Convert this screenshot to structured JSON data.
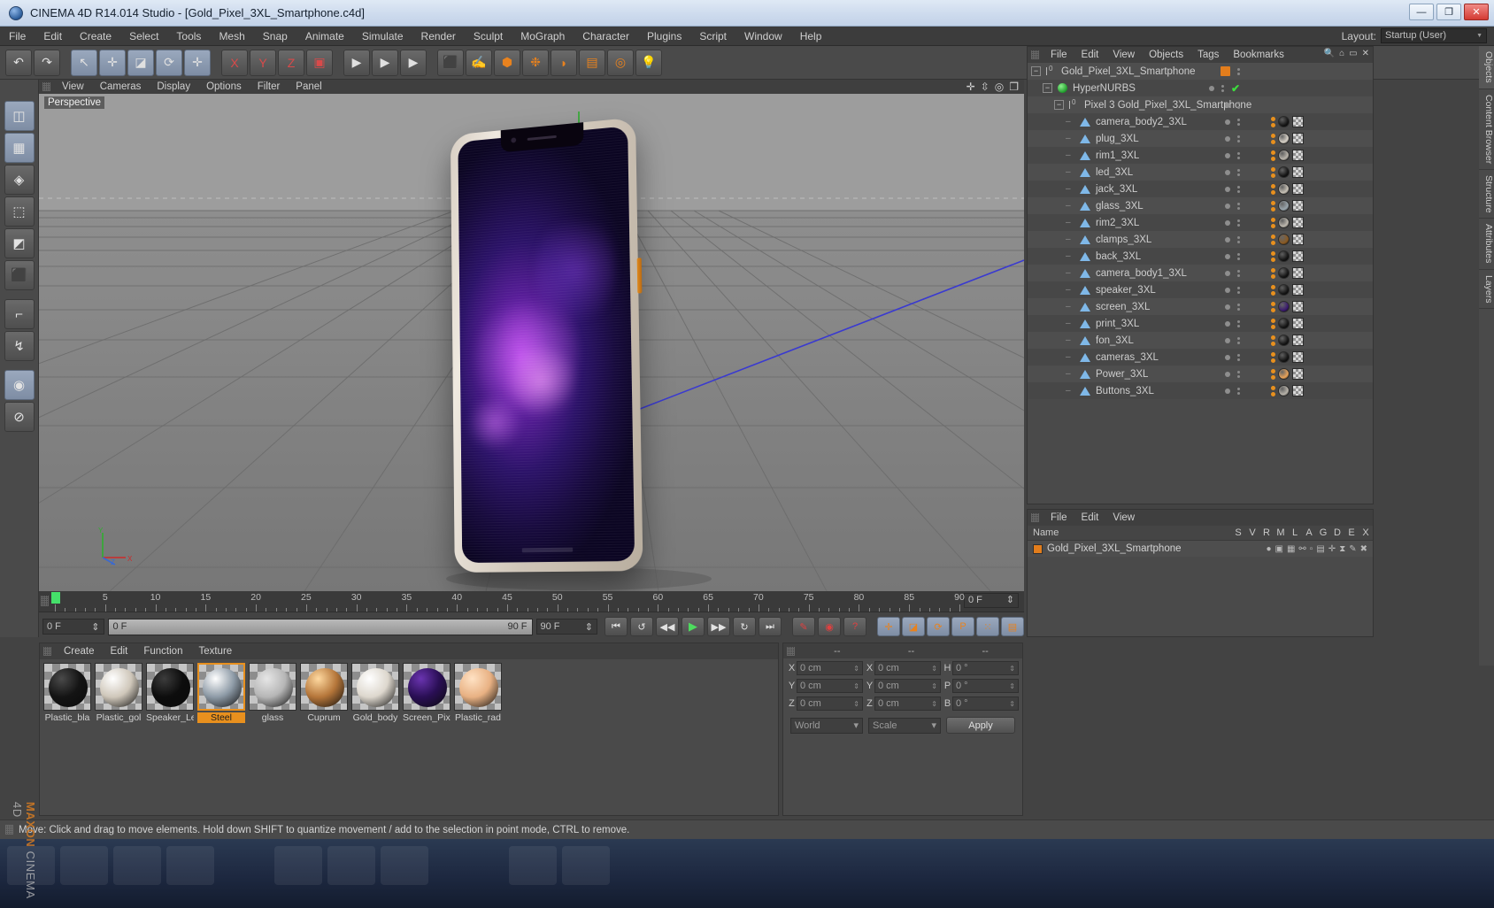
{
  "window": {
    "title": "CINEMA 4D R14.014 Studio - [Gold_Pixel_3XL_Smartphone.c4d]",
    "app_icon": "cinema4d-logo-icon",
    "minimize": "—",
    "maximize": "❐",
    "close": "✕"
  },
  "menubar": {
    "items": [
      "File",
      "Edit",
      "Create",
      "Select",
      "Tools",
      "Mesh",
      "Snap",
      "Animate",
      "Simulate",
      "Render",
      "Sculpt",
      "MoGraph",
      "Character",
      "Plugins",
      "Script",
      "Window",
      "Help"
    ],
    "layout_label": "Layout:",
    "layout_value": "Startup (User)"
  },
  "toolbar": {
    "buttons": [
      {
        "name": "undo-button",
        "glyph": "↶"
      },
      {
        "name": "redo-button",
        "glyph": "↷"
      },
      {
        "name": "select-tool-button",
        "glyph": "↖",
        "active": true
      },
      {
        "name": "move-tool-button",
        "glyph": "✛",
        "active": true
      },
      {
        "name": "scale-tool-button",
        "glyph": "◪",
        "active": true
      },
      {
        "name": "rotate-tool-button",
        "glyph": "⟳",
        "active": true
      },
      {
        "name": "add-tool-button",
        "glyph": "✛",
        "active": true
      },
      {
        "name": "lock-x-axis-button",
        "glyph": "X"
      },
      {
        "name": "lock-y-axis-button",
        "glyph": "Y"
      },
      {
        "name": "lock-z-axis-button",
        "glyph": "Z"
      },
      {
        "name": "world-object-coordinate-button",
        "glyph": "▣"
      },
      {
        "name": "render-view-button",
        "glyph": "▶"
      },
      {
        "name": "render-region-button",
        "glyph": "▶"
      },
      {
        "name": "render-settings-button",
        "glyph": "▶"
      },
      {
        "name": "add-cube-button",
        "glyph": "⬛"
      },
      {
        "name": "add-spline-button",
        "glyph": "✍"
      },
      {
        "name": "add-generator-button",
        "glyph": "⬢"
      },
      {
        "name": "add-mograph-button",
        "glyph": "❉"
      },
      {
        "name": "add-deformer-button",
        "glyph": "◗"
      },
      {
        "name": "add-scene-button",
        "glyph": "▤"
      },
      {
        "name": "add-camera-button",
        "glyph": "◎"
      },
      {
        "name": "add-light-button",
        "glyph": "💡"
      }
    ]
  },
  "left_tools": [
    {
      "name": "make-editable-button",
      "glyph": "◫",
      "active": true
    },
    {
      "name": "model-mode-button",
      "glyph": "▦",
      "active": true
    },
    {
      "name": "texture-mode-button",
      "glyph": "◈",
      "active": false
    },
    {
      "name": "point-mode-button",
      "glyph": "⬚",
      "active": false
    },
    {
      "name": "edge-mode-button",
      "glyph": "◩",
      "active": false
    },
    {
      "name": "polygon-mode-button",
      "glyph": "⬛",
      "active": false
    },
    {
      "name": "axis-mode-button",
      "glyph": "⌐",
      "active": false
    },
    {
      "name": "enable-snapping-button",
      "glyph": "↯",
      "active": false
    },
    {
      "name": "viewport-solo-button",
      "glyph": "◉",
      "active": true
    },
    {
      "name": "lock-workplane-button",
      "glyph": "⊘",
      "active": false
    }
  ],
  "viewport": {
    "menu": [
      "View",
      "Cameras",
      "Display",
      "Options",
      "Filter",
      "Panel"
    ],
    "label": "Perspective",
    "nav_icons": [
      "pan-icon",
      "dolly-icon",
      "orbit-icon",
      "maximize-viewport-icon"
    ],
    "axis": {
      "x": "X",
      "y": "Y",
      "z": "Z"
    }
  },
  "object_manager": {
    "menu": [
      "File",
      "Edit",
      "View",
      "Objects",
      "Tags",
      "Bookmarks"
    ],
    "header_icons": [
      "search-icon",
      "home-icon",
      "collapse-icon",
      "close-icon"
    ],
    "items": [
      {
        "label": "Gold_Pixel_3XL_Smartphone",
        "icon": "null-object-icon",
        "depth": 0,
        "expander": "−",
        "swatch": "#e27d1c",
        "has_tags": false,
        "check": false
      },
      {
        "label": "HyperNURBS",
        "icon": "hypernurbs-icon",
        "depth": 1,
        "expander": "−",
        "swatch": "",
        "has_tags": false,
        "check": true
      },
      {
        "label": "Pixel 3 Gold_Pixel_3XL_Smartphone",
        "icon": "null-object-icon",
        "depth": 2,
        "expander": "−",
        "swatch": "",
        "has_tags": false,
        "check": false
      },
      {
        "label": "camera_body2_3XL",
        "icon": "polygon-object-icon",
        "depth": 3,
        "expander": "",
        "swatch": "",
        "has_tags": true,
        "mat": "#151515"
      },
      {
        "label": "plug_3XL",
        "icon": "polygon-object-icon",
        "depth": 3,
        "expander": "",
        "swatch": "",
        "has_tags": true,
        "mat": "#d8d2c8"
      },
      {
        "label": "rim1_3XL",
        "icon": "polygon-object-icon",
        "depth": 3,
        "expander": "",
        "swatch": "",
        "has_tags": true,
        "mat": "#b9b4ab"
      },
      {
        "label": "led_3XL",
        "icon": "polygon-object-icon",
        "depth": 3,
        "expander": "",
        "swatch": "",
        "has_tags": true,
        "mat": "#151515"
      },
      {
        "label": "jack_3XL",
        "icon": "polygon-object-icon",
        "depth": 3,
        "expander": "",
        "swatch": "",
        "has_tags": true,
        "mat": "#c8c2b6"
      },
      {
        "label": "glass_3XL",
        "icon": "polygon-object-icon",
        "depth": 3,
        "expander": "",
        "swatch": "",
        "has_tags": true,
        "mat": "#9aa6ad"
      },
      {
        "label": "rim2_3XL",
        "icon": "polygon-object-icon",
        "depth": 3,
        "expander": "",
        "swatch": "",
        "has_tags": true,
        "mat": "#bdb8ae"
      },
      {
        "label": "clamps_3XL",
        "icon": "polygon-object-icon",
        "depth": 3,
        "expander": "",
        "swatch": "",
        "has_tags": true,
        "mat": "#8a5a23"
      },
      {
        "label": "back_3XL",
        "icon": "polygon-object-icon",
        "depth": 3,
        "expander": "",
        "swatch": "",
        "has_tags": true,
        "mat": "#151515"
      },
      {
        "label": "camera_body1_3XL",
        "icon": "polygon-object-icon",
        "depth": 3,
        "expander": "",
        "swatch": "",
        "has_tags": true,
        "mat": "#151515"
      },
      {
        "label": "speaker_3XL",
        "icon": "polygon-object-icon",
        "depth": 3,
        "expander": "",
        "swatch": "",
        "has_tags": true,
        "mat": "#151515"
      },
      {
        "label": "screen_3XL",
        "icon": "polygon-object-icon",
        "depth": 3,
        "expander": "",
        "swatch": "",
        "has_tags": true,
        "mat": "#3a1a6e"
      },
      {
        "label": "print_3XL",
        "icon": "polygon-object-icon",
        "depth": 3,
        "expander": "",
        "swatch": "",
        "has_tags": true,
        "mat": "#151515"
      },
      {
        "label": "fon_3XL",
        "icon": "polygon-object-icon",
        "depth": 3,
        "expander": "",
        "swatch": "",
        "has_tags": true,
        "mat": "#151515"
      },
      {
        "label": "cameras_3XL",
        "icon": "polygon-object-icon",
        "depth": 3,
        "expander": "",
        "swatch": "",
        "has_tags": true,
        "mat": "#151515"
      },
      {
        "label": "Power_3XL",
        "icon": "polygon-object-icon",
        "depth": 3,
        "expander": "",
        "swatch": "",
        "has_tags": true,
        "mat": "#e8a35a"
      },
      {
        "label": "Buttons_3XL",
        "icon": "polygon-object-icon",
        "depth": 3,
        "expander": "",
        "swatch": "",
        "has_tags": true,
        "mat": "#b8b3aa"
      }
    ]
  },
  "attributes_panel": {
    "menu": [
      "File",
      "Edit",
      "View"
    ],
    "columns": [
      "Name",
      "S",
      "V",
      "R",
      "M",
      "L",
      "A",
      "G",
      "D",
      "E",
      "X"
    ],
    "rows": [
      {
        "name": "Gold_Pixel_3XL_Smartphone",
        "swatch": "#e27d1c"
      }
    ]
  },
  "right_dock_tabs": [
    {
      "label": "Objects",
      "selected": true
    },
    {
      "label": "Content Browser",
      "selected": false
    },
    {
      "label": "Structure",
      "selected": false
    },
    {
      "label": "Attributes",
      "selected": false
    },
    {
      "label": "Layers",
      "selected": false
    }
  ],
  "timeline": {
    "ruler_labels": [
      "0",
      "5",
      "10",
      "15",
      "20",
      "25",
      "30",
      "35",
      "40",
      "45",
      "50",
      "55",
      "60",
      "65",
      "70",
      "75",
      "80",
      "85",
      "90"
    ],
    "current_frame_right": "0 F",
    "current_frame_field": "0 F",
    "range_start": "0 F",
    "range_end": "90 F",
    "max_frame_field": "90 F",
    "playhead_frame": 0,
    "transport": [
      {
        "name": "go-to-start-button",
        "glyph": "⏮"
      },
      {
        "name": "play-reverse-button",
        "glyph": "↺"
      },
      {
        "name": "step-back-button",
        "glyph": "◀◀"
      },
      {
        "name": "play-button",
        "glyph": "▶"
      },
      {
        "name": "step-forward-button",
        "glyph": "▶▶"
      },
      {
        "name": "loop-button",
        "glyph": "↻"
      },
      {
        "name": "go-to-end-button",
        "glyph": "⏭"
      }
    ],
    "record_tools": [
      {
        "name": "autokeying-button",
        "glyph": "✎"
      },
      {
        "name": "record-active-objects-button",
        "glyph": "◉"
      },
      {
        "name": "keyframe-selection-button",
        "glyph": "?"
      }
    ],
    "key_tools": [
      {
        "name": "position-key-button",
        "glyph": "✛"
      },
      {
        "name": "scale-key-button",
        "glyph": "◪"
      },
      {
        "name": "rotation-key-button",
        "glyph": "⟳"
      },
      {
        "name": "param-key-button",
        "glyph": "P"
      },
      {
        "name": "pla-key-button",
        "glyph": "⁙"
      },
      {
        "name": "key-mode-button",
        "glyph": "▤"
      }
    ]
  },
  "material_manager": {
    "menu": [
      "Create",
      "Edit",
      "Function",
      "Texture"
    ],
    "materials": [
      {
        "name": "Plastic_black",
        "display": "Plastic_bla",
        "color": "#141414",
        "hl": "#4a4a4a",
        "selected": false
      },
      {
        "name": "Plastic_gold",
        "display": "Plastic_gol",
        "color": "#cfc7ba",
        "hl": "#ffffff",
        "selected": false
      },
      {
        "name": "Speaker_Led",
        "display": "Speaker_Le",
        "color": "#0d0d0d",
        "hl": "#3c3c3c",
        "selected": false
      },
      {
        "name": "Steel",
        "display": "Steel",
        "color": "#8d9aa6",
        "hl": "#ffffff",
        "selected": true
      },
      {
        "name": "glass",
        "display": "glass",
        "color": "#b6b6b6",
        "hl": "#e6e6e6",
        "selected": false
      },
      {
        "name": "Cuprum",
        "display": "Cuprum",
        "color": "#b5763a",
        "hl": "#ffd9a0",
        "selected": false
      },
      {
        "name": "Gold_body",
        "display": "Gold_body",
        "color": "#ddd7cd",
        "hl": "#ffffff",
        "selected": false
      },
      {
        "name": "Screen_Pixel",
        "display": "Screen_Pixe",
        "color": "#2a0f55",
        "hl": "#6a34b0",
        "selected": false
      },
      {
        "name": "Plastic_rad",
        "display": "Plastic_rad",
        "color": "#e8b183",
        "hl": "#ffe2c4",
        "selected": false
      }
    ]
  },
  "coordinates": {
    "header": [
      "--",
      "--",
      "--"
    ],
    "rows": [
      {
        "axis1": "X",
        "val1": "0 cm",
        "axis2": "X",
        "val2": "0 cm",
        "axis3": "H",
        "val3": "0 °"
      },
      {
        "axis1": "Y",
        "val1": "0 cm",
        "axis2": "Y",
        "val2": "0 cm",
        "axis3": "P",
        "val3": "0 °"
      },
      {
        "axis1": "Z",
        "val1": "0 cm",
        "axis2": "Z",
        "val2": "0 cm",
        "axis3": "B",
        "val3": "0 °"
      }
    ],
    "system_select": "World",
    "mode_select": "Scale",
    "apply_label": "Apply"
  },
  "status_bar": {
    "text": "Move: Click and drag to move elements. Hold down SHIFT to quantize movement / add to the selection in point mode, CTRL to remove."
  },
  "watermark": {
    "brand": "MAXON",
    "product": "CINEMA 4D"
  }
}
